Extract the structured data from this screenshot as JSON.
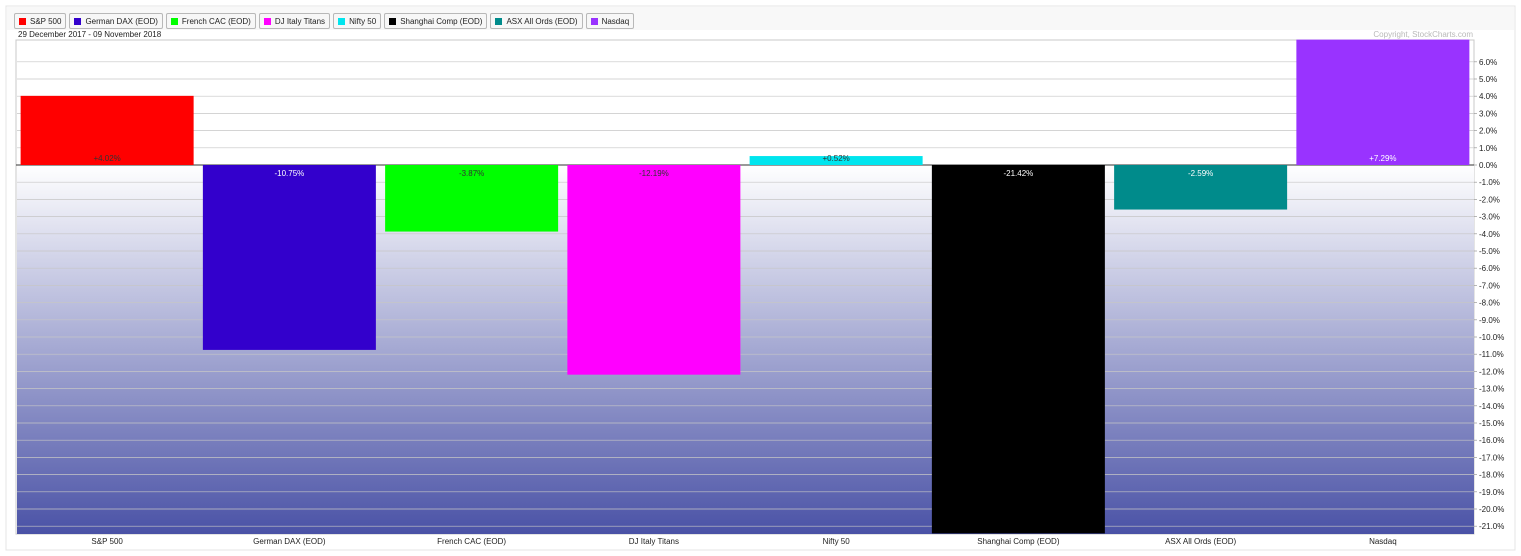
{
  "legend": [
    {
      "label": "S&P 500",
      "color": "#ff0000"
    },
    {
      "label": "German DAX (EOD)",
      "color": "#3300cc"
    },
    {
      "label": "French CAC (EOD)",
      "color": "#00ff00"
    },
    {
      "label": "DJ Italy Titans",
      "color": "#ff00ff"
    },
    {
      "label": "Nifty 50",
      "color": "#00e5ee"
    },
    {
      "label": "Shanghai Comp (EOD)",
      "color": "#000000"
    },
    {
      "label": "ASX All Ords (EOD)",
      "color": "#008b8b"
    },
    {
      "label": "Nasdaq",
      "color": "#9933ff"
    }
  ],
  "header": {
    "date_range": "29 December 2017 - 09 November 2018",
    "copyright": "Copyright, StockCharts.com"
  },
  "chart_data": {
    "type": "bar",
    "categories": [
      "S&P 500",
      "German DAX (EOD)",
      "French CAC (EOD)",
      "DJ Italy Titans",
      "Nifty 50",
      "Shanghai Comp (EOD)",
      "ASX All Ords (EOD)",
      "Nasdaq"
    ],
    "values": [
      4.02,
      -10.75,
      -3.87,
      -12.19,
      0.52,
      -21.42,
      -2.59,
      7.29
    ],
    "value_labels": [
      "+4.02%",
      "-10.75%",
      "-3.87%",
      "-12.19%",
      "+0.52%",
      "-21.42%",
      "-2.59%",
      "+7.29%"
    ],
    "colors": [
      "#ff0000",
      "#3300cc",
      "#00ff00",
      "#ff00ff",
      "#00e5ee",
      "#000000",
      "#008b8b",
      "#9933ff"
    ],
    "yticks": [
      6,
      5,
      4,
      3,
      2,
      1,
      0,
      -1,
      -2,
      -3,
      -4,
      -5,
      -6,
      -7,
      -8,
      -9,
      -10,
      -11,
      -12,
      -13,
      -14,
      -15,
      -16,
      -17,
      -18,
      -19,
      -20,
      -21
    ],
    "ytick_labels": [
      "6.0%",
      "5.0%",
      "4.0%",
      "3.0%",
      "2.0%",
      "1.0%",
      "0.0%",
      "-1.0%",
      "-2.0%",
      "-3.0%",
      "-4.0%",
      "-5.0%",
      "-6.0%",
      "-7.0%",
      "-8.0%",
      "-9.0%",
      "-10.0%",
      "-11.0%",
      "-12.0%",
      "-13.0%",
      "-14.0%",
      "-15.0%",
      "-16.0%",
      "-17.0%",
      "-18.0%",
      "-19.0%",
      "-20.0%",
      "-21.0%"
    ],
    "ylim": [
      -21.6,
      7.3
    ],
    "grid": true,
    "title": "",
    "xlabel": "",
    "ylabel": ""
  }
}
